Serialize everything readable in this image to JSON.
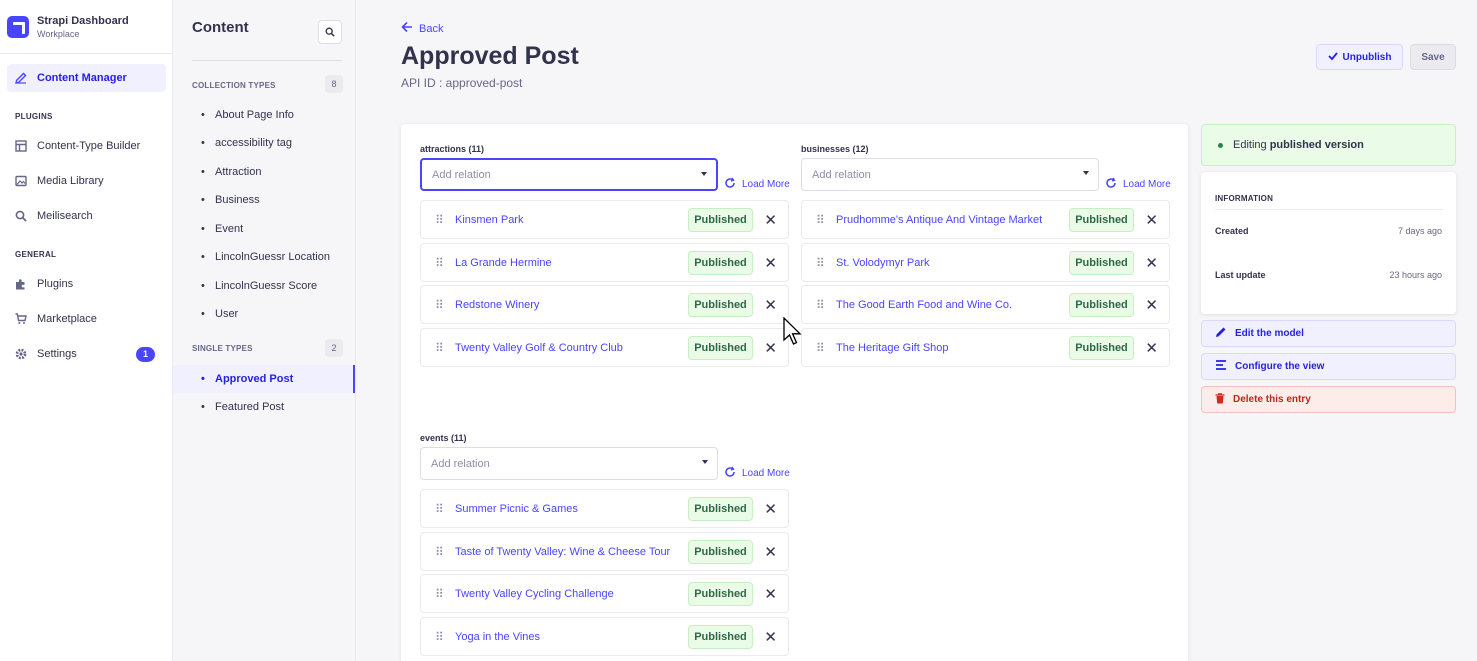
{
  "brand": {
    "title": "Strapi Dashboard",
    "subtitle": "Workplace"
  },
  "nav": {
    "active": {
      "label": "Content Manager",
      "icon": "pencil-icon"
    },
    "plugins_heading": "PLUGINS",
    "plugins": [
      {
        "label": "Content-Type Builder",
        "icon": "layout-icon"
      },
      {
        "label": "Media Library",
        "icon": "image-icon"
      },
      {
        "label": "Meilisearch",
        "icon": "search-icon"
      }
    ],
    "general_heading": "GENERAL",
    "general": [
      {
        "label": "Plugins",
        "icon": "puzzle-icon"
      },
      {
        "label": "Marketplace",
        "icon": "cart-icon"
      },
      {
        "label": "Settings",
        "icon": "gear-icon",
        "badge": "1"
      }
    ]
  },
  "subnav": {
    "title": "Content",
    "collection_heading": "COLLECTION TYPES",
    "collection_count": "8",
    "collection_items": [
      "About Page Info",
      "accessibility tag",
      "Attraction",
      "Business",
      "Event",
      "LincolnGuessr Location",
      "LincolnGuessr Score",
      "User"
    ],
    "single_heading": "SINGLE TYPES",
    "single_count": "2",
    "single_items": [
      "Approved Post",
      "Featured Post"
    ]
  },
  "header": {
    "back": "Back",
    "title": "Approved Post",
    "api_id": "API ID : approved-post",
    "unpublish": "Unpublish",
    "save": "Save"
  },
  "relations": {
    "placeholder": "Add relation",
    "load_more": "Load More",
    "status": "Published",
    "attractions": {
      "label": "attractions (11)",
      "items": [
        "Kinsmen Park",
        "La Grande Hermine",
        "Redstone Winery",
        "Twenty Valley Golf & Country Club"
      ]
    },
    "businesses": {
      "label": "businesses (12)",
      "items": [
        "Prudhomme's Antique And Vintage Market",
        "St. Volodymyr Park",
        "The Good Earth Food and Wine Co.",
        "The Heritage Gift Shop"
      ]
    },
    "events": {
      "label": "events (11)",
      "items": [
        "Summer Picnic & Games",
        "Taste of Twenty Valley: Wine & Cheese Tour",
        "Twenty Valley Cycling Challenge",
        "Yoga in the Vines"
      ]
    }
  },
  "sidebar": {
    "status_prefix": "Editing ",
    "status_strong": "published version",
    "info_title": "INFORMATION",
    "created_label": "Created",
    "created_value": "7 days ago",
    "updated_label": "Last update",
    "updated_value": "23 hours ago",
    "edit_model": "Edit the model",
    "configure_view": "Configure the view",
    "delete_entry": "Delete this entry"
  },
  "colors": {
    "primary": "#4945ff",
    "success_bg": "#eafbe7",
    "danger": "#b72b1a"
  }
}
